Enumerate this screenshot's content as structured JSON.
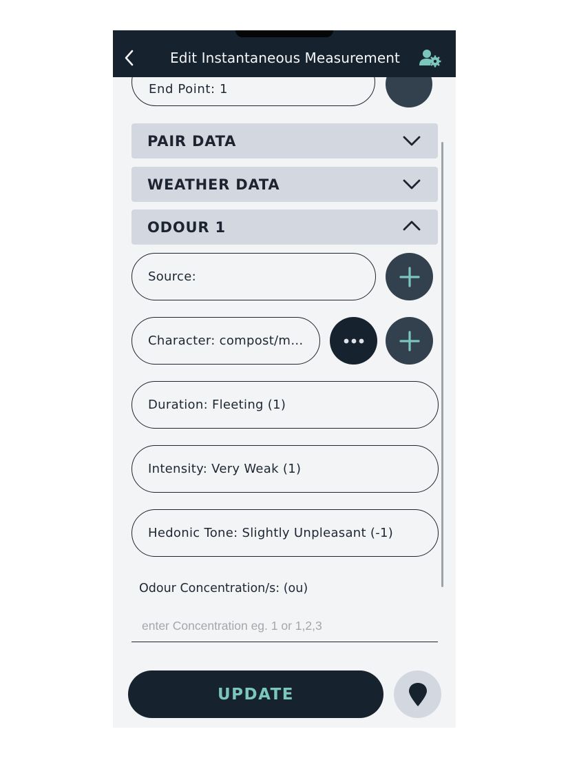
{
  "header": {
    "title": "Edit Instantaneous Measurement",
    "back_icon": "chevron-left-icon",
    "settings_icon": "user-settings-icon",
    "background": "#17222f"
  },
  "partial_field": {
    "label": "End Point: 1"
  },
  "sections": [
    {
      "label": "PAIR DATA",
      "state": "collapsed",
      "icon": "chevron-down-icon"
    },
    {
      "label": "WEATHER DATA",
      "state": "collapsed",
      "icon": "chevron-down-icon"
    },
    {
      "label": "ODOUR 1",
      "state": "expanded",
      "icon": "chevron-up-icon"
    }
  ],
  "fields": {
    "source": "Source:",
    "character": "Character: compost/mul…",
    "duration": "Duration: Fleeting (1)",
    "intensity": "Intensity: Very Weak (1)",
    "hedonic_tone": "Hedonic Tone: Slightly Unpleasant (-1)"
  },
  "concentration": {
    "label": "Odour Concentration/s: (ou)",
    "placeholder": "enter Concentration eg. 1 or 1,2,3",
    "value": ""
  },
  "actions": {
    "update_label": "UPDATE",
    "location_icon": "location-pin-icon"
  },
  "colors": {
    "accent": "#7cc7bd",
    "dark": "#17222f",
    "slate": "#33414f",
    "section_bg": "#d3d8e0",
    "page_bg": "#f3f4f6"
  }
}
